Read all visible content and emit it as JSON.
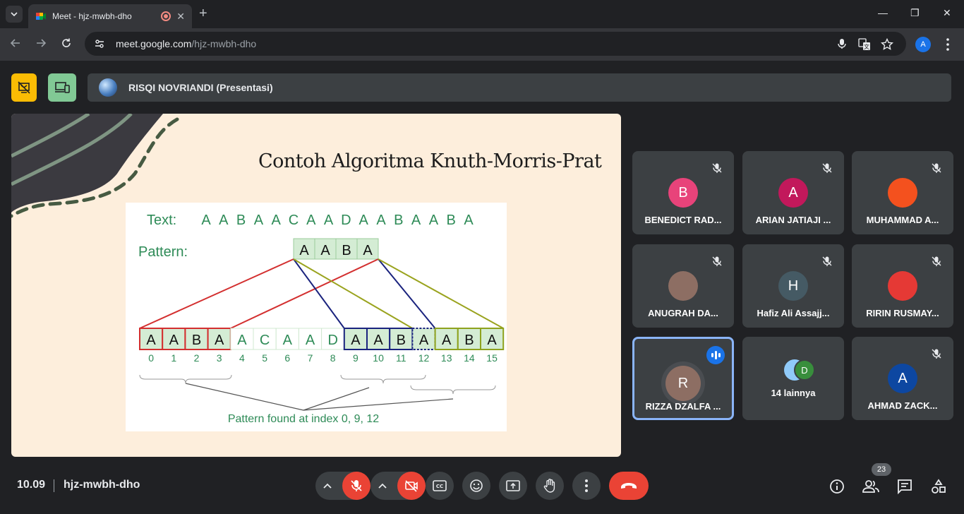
{
  "browser": {
    "tab_title": "Meet - hjz-mwbh-dho",
    "new_tab": "+",
    "url_host": "meet.google.com",
    "url_path": "/hjz-mwbh-dho",
    "profile_initial": "A",
    "window_controls": [
      "—",
      "❐",
      "✕"
    ]
  },
  "meet": {
    "presenter_label": "RISQI NOVRIANDI (Presentasi)",
    "slide": {
      "title": "Contoh Algoritma Knuth-Morris-Prat",
      "figure": {
        "text_label": "Text:",
        "text_chars": [
          "A",
          "A",
          "B",
          "A",
          "A",
          "C",
          "A",
          "A",
          "D",
          "A",
          "A",
          "B",
          "A",
          "A",
          "B",
          "A"
        ],
        "pattern_label": "Pattern:",
        "pattern_chars": [
          "A",
          "A",
          "B",
          "A"
        ],
        "boxes": [
          "A",
          "A",
          "B",
          "A",
          "A",
          "C",
          "A",
          "A",
          "D",
          "A",
          "A",
          "B",
          "A",
          "A",
          "B",
          "A"
        ],
        "indices": [
          "0",
          "1",
          "2",
          "3",
          "4",
          "5",
          "6",
          "7",
          "8",
          "9",
          "10",
          "11",
          "12",
          "13",
          "14",
          "15"
        ],
        "result": "Pattern found at index 0, 9, 12"
      }
    },
    "participants": [
      {
        "name": "BENEDICT RAD...",
        "initial": "B",
        "color": "#e8437a",
        "muted": true
      },
      {
        "name": "ARIAN JATIAJI ...",
        "initial": "A",
        "color": "#c2185b",
        "muted": true
      },
      {
        "name": "MUHAMMAD A...",
        "initial": "",
        "color": "#f4511e",
        "muted": true
      },
      {
        "name": "ANUGRAH DA...",
        "initial": "",
        "color": "#8d6e63",
        "muted": true
      },
      {
        "name": "Hafiz Ali Assajj...",
        "initial": "H",
        "color": "#455a64",
        "muted": true
      },
      {
        "name": "RIRIN RUSMAY...",
        "initial": "",
        "color": "#e53935",
        "muted": true
      },
      {
        "name": "RIZZA DZALFA ...",
        "initial": "R",
        "color": "#8d6e63",
        "muted": false
      },
      {
        "name": "14 lainnya",
        "initial": "D",
        "color": "#388e3c",
        "muted": false
      },
      {
        "name": "AHMAD ZACK...",
        "initial": "A",
        "color": "#0d47a1",
        "muted": true
      }
    ],
    "bottom": {
      "time": "10.09",
      "meeting_code": "hjz-mwbh-dho",
      "people_count": "23"
    }
  }
}
